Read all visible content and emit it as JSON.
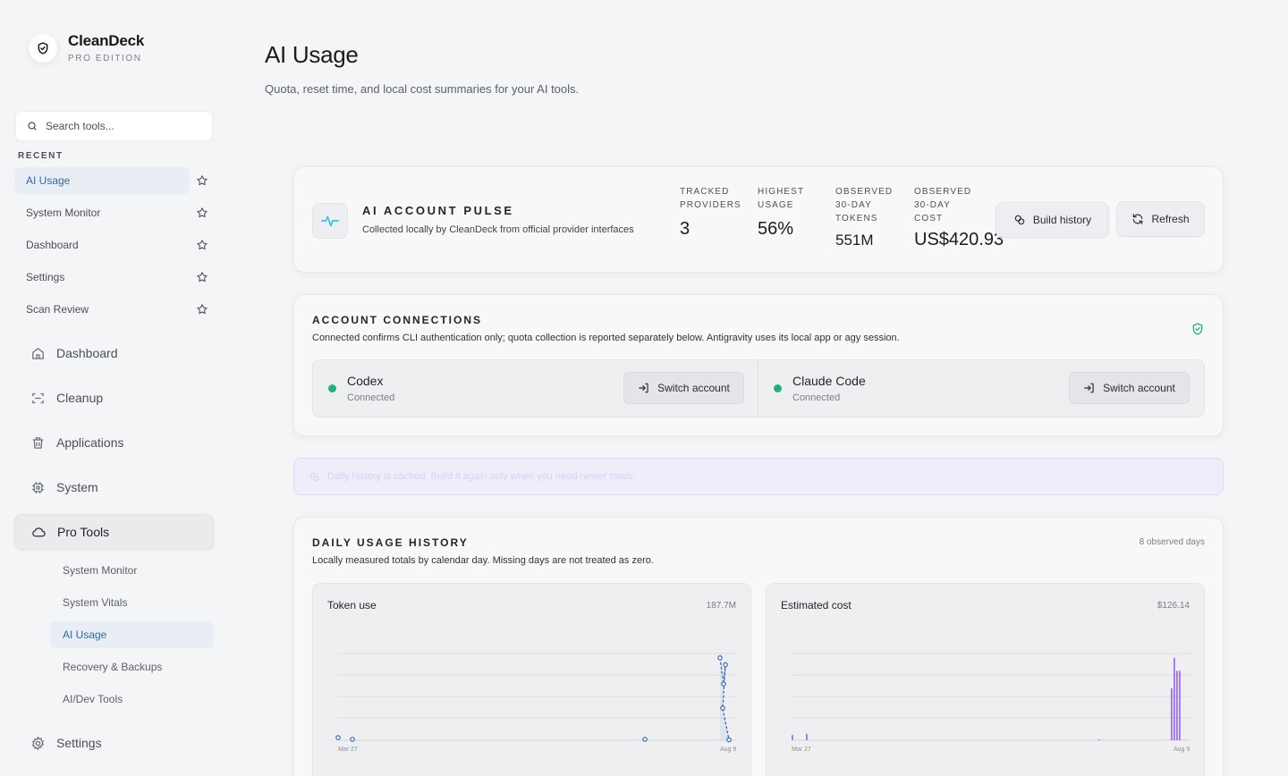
{
  "brand": {
    "name": "CleanDeck",
    "edition": "PRO EDITION"
  },
  "search": {
    "placeholder": "Search tools..."
  },
  "recent": {
    "label": "RECENT",
    "items": [
      {
        "label": "AI Usage"
      },
      {
        "label": "System Monitor"
      },
      {
        "label": "Dashboard"
      },
      {
        "label": "Settings"
      },
      {
        "label": "Scan Review"
      }
    ]
  },
  "nav": {
    "dashboard": "Dashboard",
    "cleanup": "Cleanup",
    "applications": "Applications",
    "system": "System",
    "pro_tools": "Pro Tools",
    "settings": "Settings",
    "sub": [
      "System Monitor",
      "System Vitals",
      "AI Usage",
      "Recovery & Backups",
      "AI/Dev Tools"
    ]
  },
  "page": {
    "title": "AI Usage",
    "subtitle": "Quota, reset time, and local cost summaries for your AI tools."
  },
  "pulse": {
    "title": "AI ACCOUNT PULSE",
    "subtitle": "Collected locally by CleanDeck from official provider interfaces",
    "stats": [
      {
        "label": "TRACKED\nPROVIDERS",
        "value": "3"
      },
      {
        "label": "HIGHEST\nUSAGE",
        "value": "56%"
      },
      {
        "label": "OBSERVED\n30-DAY\nTOKENS",
        "value": "551M"
      },
      {
        "label": "OBSERVED\n30-DAY\nCOST",
        "value": "US$420.93"
      }
    ],
    "build_history": "Build history",
    "refresh": "Refresh"
  },
  "connections": {
    "title": "ACCOUNT CONNECTIONS",
    "subtitle": "Connected confirms CLI authentication only; quota collection is reported separately below. Antigravity uses its local app or agy session.",
    "accounts": [
      {
        "name": "Codex",
        "status": "Connected",
        "action": "Switch account"
      },
      {
        "name": "Claude Code",
        "status": "Connected",
        "action": "Switch account"
      }
    ]
  },
  "banner": {
    "text": "Daily history is cached. Build it again only when you need newer totals."
  },
  "history": {
    "title": "DAILY USAGE HISTORY",
    "meta": "8 observed days",
    "subtitle": "Locally measured totals by calendar day. Missing days are not treated as zero."
  },
  "chart_data": [
    {
      "type": "line",
      "title": "Token use",
      "total": "187.7M",
      "x_tick_labels": [
        "Mar 27",
        "Aug 9"
      ],
      "series": [
        {
          "values": [
            3.0,
            1.0,
            1.0,
            95.0,
            65.0,
            87.0,
            37.0,
            0.5
          ]
        }
      ],
      "color": "#2f6bb3"
    },
    {
      "type": "bar",
      "title": "Estimated cost",
      "total": "$126.14",
      "x_tick_labels": [
        "Mar 27",
        "Aug 9"
      ],
      "series": [
        {
          "values": [
            1.2,
            1.5,
            0.2,
            12.0,
            19.0,
            16.0,
            16.0
          ]
        }
      ],
      "color": "#8b5cf6"
    }
  ]
}
